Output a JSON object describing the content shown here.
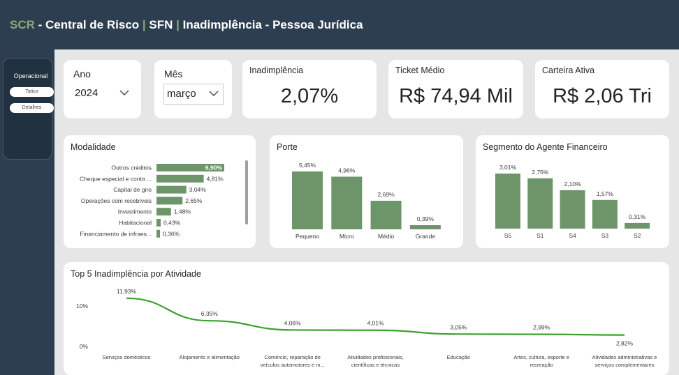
{
  "header": {
    "prefix": "SCR",
    "part1": " - Central de Risco ",
    "sep1": "|",
    "part2": " SFN ",
    "sep2": "|",
    "part3": " Inadimplência - Pessoa Jurídica"
  },
  "sidebar": {
    "active": "Operacional",
    "buttons": [
      "Tatico",
      "Detalhes"
    ]
  },
  "slicers": {
    "ano": {
      "label": "Ano",
      "value": "2024"
    },
    "mes": {
      "label": "Mês",
      "value": "março"
    }
  },
  "kpis": {
    "inadimplencia": {
      "label": "Inadimplência",
      "value": "2,07%"
    },
    "ticket": {
      "label": "Ticket Médio",
      "value": "R$ 74,94 Mil"
    },
    "carteira": {
      "label": "Carteira Ativa",
      "value": "R$ 2,06 Tri"
    }
  },
  "colors": {
    "bar": "#6e956a",
    "line": "#3aa22c",
    "header": "#2c3e50",
    "accent": "#8aa87a"
  },
  "chart_data": [
    {
      "type": "bar",
      "orientation": "horizontal",
      "title": "Modalidade",
      "categories": [
        "Outros créditos",
        "Cheque especial e conta ...",
        "Capital de giro",
        "Operações com recebíveis",
        "Investimento",
        "Habitacional",
        "Financiamento de infraes..."
      ],
      "values": [
        6.9,
        4.81,
        3.04,
        2.65,
        1.48,
        0.43,
        0.36
      ],
      "labels": [
        "6,90%",
        "4,81%",
        "3,04%",
        "2,65%",
        "1,48%",
        "0,43%",
        "0,36%"
      ]
    },
    {
      "type": "bar",
      "title": "Porte",
      "categories": [
        "Pequeno",
        "Micro",
        "Médio",
        "Grande"
      ],
      "values": [
        5.45,
        4.96,
        2.69,
        0.39
      ],
      "labels": [
        "5,45%",
        "4,96%",
        "2,69%",
        "0,39%"
      ]
    },
    {
      "type": "bar",
      "title": "Segmento do Agente Financeiro",
      "categories": [
        "S5",
        "S1",
        "S4",
        "S3",
        "S2"
      ],
      "values": [
        3.01,
        2.75,
        2.1,
        1.57,
        0.31
      ],
      "labels": [
        "3,01%",
        "2,75%",
        "2,10%",
        "1,57%",
        "0,31%"
      ]
    },
    {
      "type": "line",
      "title": "Top 5 Inadimplência por Atividade",
      "categories": [
        [
          "Serviços domésticos"
        ],
        [
          "Alojamento e alimentação"
        ],
        [
          "Comércio, reparação de",
          "veículos automotores e m..."
        ],
        [
          "Atividades profissionais,",
          "científicas e técnicas"
        ],
        [
          "Educação"
        ],
        [
          "Artes, cultura, esporte e",
          "recreação"
        ],
        [
          "Atividades administrativas e",
          "serviços complementares"
        ]
      ],
      "values": [
        11.93,
        6.35,
        4.06,
        4.01,
        3.05,
        2.99,
        2.82
      ],
      "labels": [
        "11,93%",
        "6,35%",
        "4,06%",
        "4,01%",
        "3,05%",
        "2,99%",
        "2,82%"
      ],
      "yticks": [
        "0%",
        "10%"
      ],
      "ylim": [
        0,
        10
      ]
    }
  ]
}
